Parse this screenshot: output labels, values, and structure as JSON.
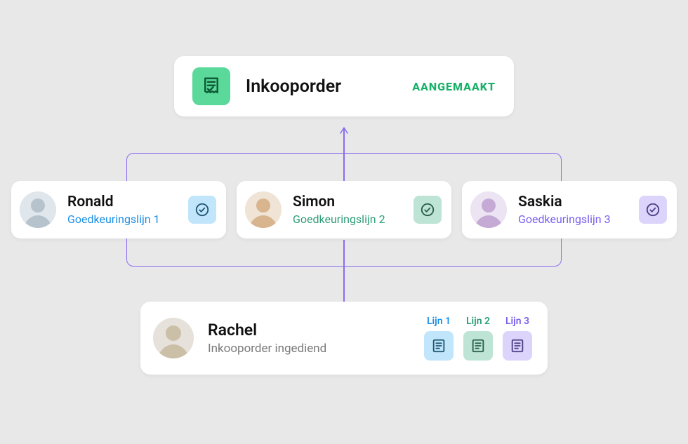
{
  "header": {
    "title": "Inkooporder",
    "status": "AANGEMAAKT"
  },
  "approvers": [
    {
      "name": "Ronald",
      "subtitle": "Goedkeuringslijn 1"
    },
    {
      "name": "Simon",
      "subtitle": "Goedkeuringslijn 2"
    },
    {
      "name": "Saskia",
      "subtitle": "Goedkeuringslijn 3"
    }
  ],
  "requester": {
    "name": "Rachel",
    "subtitle": "Inkooporder ingediend",
    "lines": [
      {
        "label": "Lijn 1"
      },
      {
        "label": "Lijn 2"
      },
      {
        "label": "Lijn 3"
      }
    ]
  }
}
